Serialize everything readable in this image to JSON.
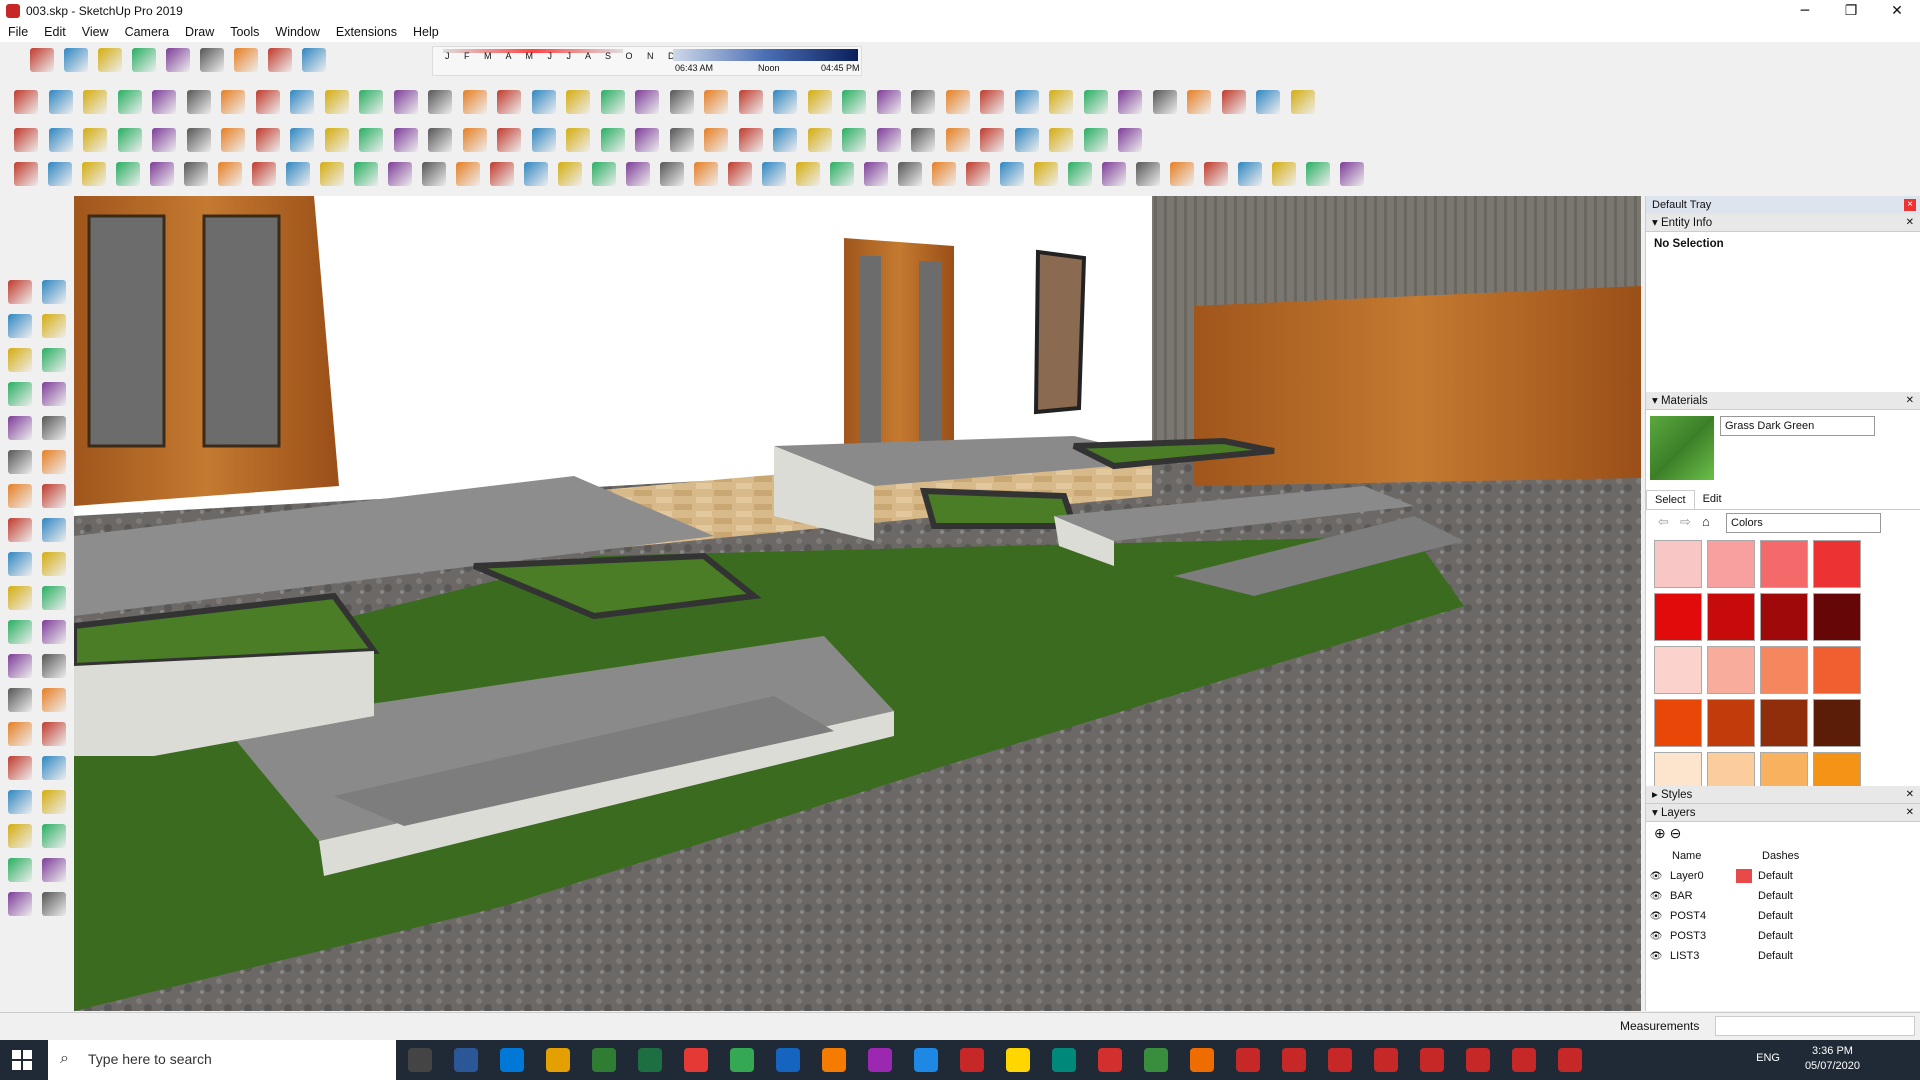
{
  "window": {
    "title": "003.skp - SketchUp Pro 2019",
    "controls": [
      "─",
      "❐",
      "✕"
    ]
  },
  "menu": [
    "File",
    "Edit",
    "View",
    "Camera",
    "Draw",
    "Tools",
    "Window",
    "Extensions",
    "Help"
  ],
  "shadow": {
    "months": "J F M A M J J A S O N D",
    "start_time": "06:43 AM",
    "mid_time": "Noon",
    "end_time": "04:45 PM"
  },
  "tray": {
    "title": "Default Tray",
    "entity_info": {
      "header": "Entity Info",
      "value": "No Selection"
    },
    "materials": {
      "header": "Materials",
      "material_name": "Grass Dark Green",
      "tabs": [
        "Select",
        "Edit"
      ],
      "library": "Colors",
      "colors": [
        "#f9c6c6",
        "#f8a0a0",
        "#f46a6a",
        "#ec3232",
        "#e20b0b",
        "#c70b0b",
        "#9f0909",
        "#670606",
        "#fbd2cc",
        "#f8ad9c",
        "#f5875f",
        "#f05f30",
        "#e94708",
        "#c23b0a",
        "#902d0a",
        "#5c1d08",
        "#fde4cc",
        "#fbcc9c",
        "#f8b15f",
        "#f39417"
      ]
    },
    "styles": {
      "header": "Styles"
    },
    "layers": {
      "header": "Layers",
      "columns": [
        "Name",
        "Dashes"
      ],
      "rows": [
        {
          "name": "Layer0",
          "dashes": "Default",
          "color": "#e84a4a"
        },
        {
          "name": "BAR",
          "dashes": "Default",
          "color": ""
        },
        {
          "name": "POST4",
          "dashes": "Default",
          "color": ""
        },
        {
          "name": "POST3",
          "dashes": "Default",
          "color": ""
        },
        {
          "name": "LIST3",
          "dashes": "Default",
          "color": ""
        }
      ]
    }
  },
  "status": {
    "measurements_label": "Measurements"
  },
  "taskbar": {
    "search_placeholder": "Type here to search",
    "lang": "ENG",
    "time": "3:36 PM",
    "date": "05/07/2020"
  }
}
